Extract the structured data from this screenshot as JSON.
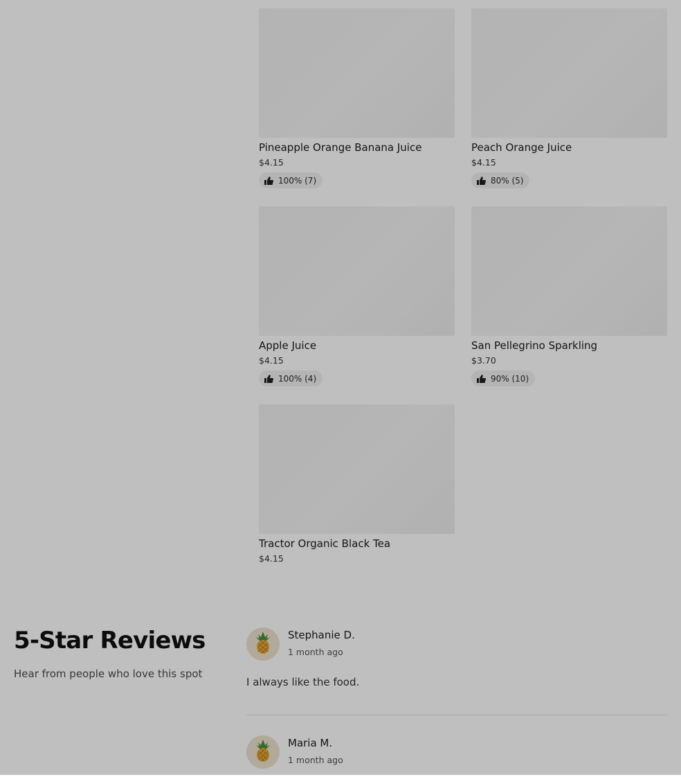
{
  "products": [
    {
      "name": "Pineapple Orange Banana Juice",
      "price": "$4.15",
      "rating": "100% (7)"
    },
    {
      "name": "Peach Orange Juice",
      "price": "$4.15",
      "rating": "80% (5)"
    },
    {
      "name": "Apple Juice",
      "price": "$4.15",
      "rating": "100% (4)"
    },
    {
      "name": "San Pellegrino Sparkling",
      "price": "$3.70",
      "rating": "90% (10)"
    },
    {
      "name": "Tractor Organic Black Tea",
      "price": "$4.15",
      "rating": ""
    }
  ],
  "reviews_section": {
    "title": "5-Star Reviews",
    "subtitle": "Hear from people who love this spot",
    "reviews": [
      {
        "name": "Stephanie D.",
        "time": "1 month ago",
        "text": "I always like the food.",
        "avatar_icon": "pineapple-icon"
      },
      {
        "name": "Maria M.",
        "time": "1 month ago",
        "text": "",
        "avatar_icon": "pineapple-icon"
      }
    ]
  },
  "colors": {
    "overlay": "#000000",
    "rating_pill": "#f1f1f1",
    "avatar_bg": "#ece3cf"
  }
}
